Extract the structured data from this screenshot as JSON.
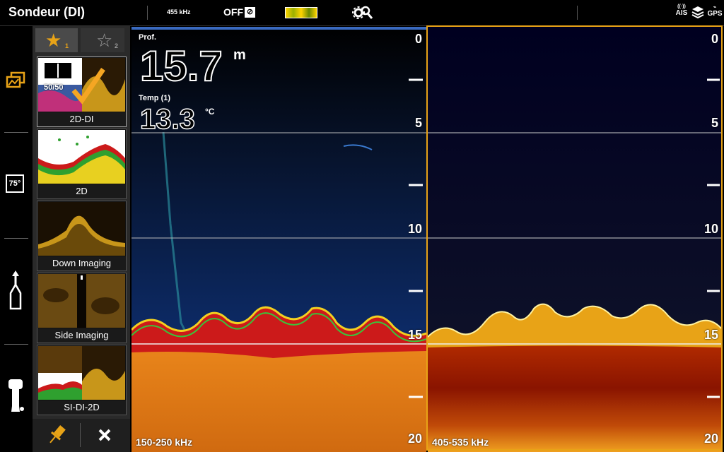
{
  "topbar": {
    "title": "Sondeur (DI)",
    "frequency": "455 kHz",
    "status": "OFF",
    "status_icons": [
      "AIS",
      "GPS"
    ]
  },
  "sidebar": {
    "icons": [
      "gallery-icon",
      "water-temp-icon",
      "boat-heading-icon",
      "outboard-motor-icon"
    ],
    "water_temp_badge": "75°"
  },
  "favorites": {
    "tab1_num": "1",
    "tab2_num": "2",
    "split_badge": "50/50",
    "items": [
      {
        "label": "2D-DI"
      },
      {
        "label": "2D"
      },
      {
        "label": "Down Imaging"
      },
      {
        "label": "Side Imaging"
      },
      {
        "label": "SI-DI-2D"
      }
    ]
  },
  "readouts": {
    "depth_label": "Prof.",
    "depth_value": "15.7",
    "depth_unit": "m",
    "temp_label": "Temp (1)",
    "temp_value": "13.3",
    "temp_unit": "°C"
  },
  "left_pane": {
    "frequency": "150-250 kHz",
    "scale_labels": [
      "0",
      "5",
      "10",
      "15",
      "20"
    ]
  },
  "right_pane": {
    "frequency": "405-535 kHz",
    "scale_labels": [
      "0",
      "5",
      "10",
      "15",
      "20"
    ]
  },
  "colors": {
    "accent": "#e8a317",
    "bottom_orange": "#e07a10",
    "bottom_red": "#8a1400",
    "water_left": "#0a1a3a",
    "water_right": "#0a0f2a"
  }
}
